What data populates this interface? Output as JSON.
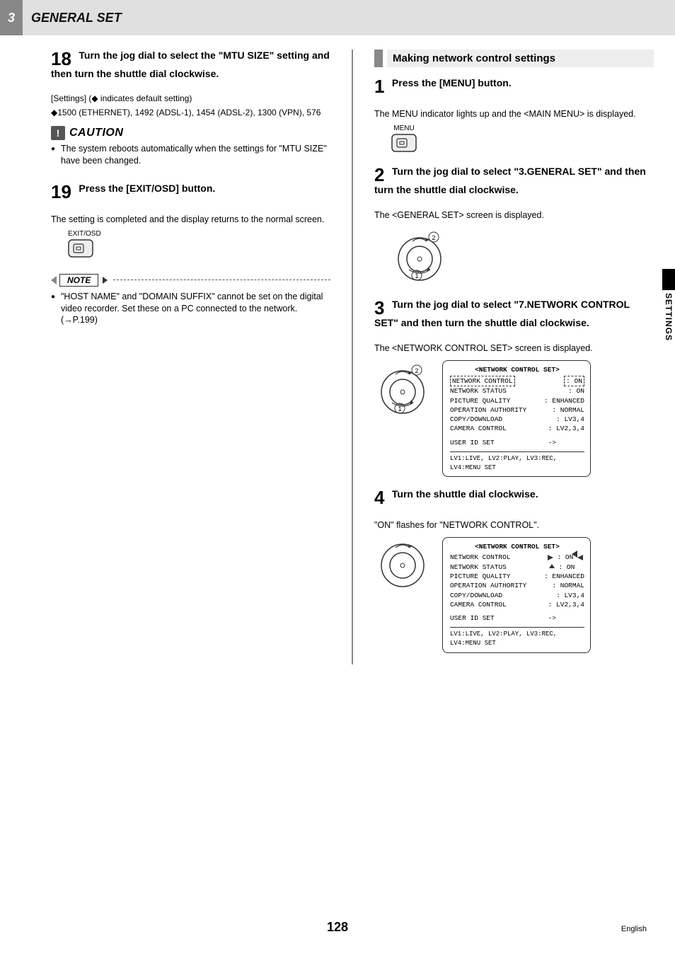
{
  "header": {
    "chapter_num": "3",
    "chapter_title": "GENERAL SET"
  },
  "side_tab": "SETTINGS",
  "footer": {
    "page": "128",
    "lang": "English"
  },
  "left": {
    "s18": {
      "num": "18",
      "title": "Turn the jog dial to select the \"MTU SIZE\" setting and then turn the shuttle dial clockwise.",
      "settings_label": "[Settings] (◆ indicates default setting)",
      "settings_body": "◆1500 (ETHERNET), 1492 (ADSL-1), 1454 (ADSL-2), 1300 (VPN), 576"
    },
    "caution": {
      "label": "CAUTION",
      "text": "The system reboots automatically when the settings for \"MTU SIZE\" have been changed."
    },
    "s19": {
      "num": "19",
      "title": "Press the [EXIT/OSD] button.",
      "body": "The setting is completed and the display returns to the normal screen.",
      "btn_label": "EXIT/OSD"
    },
    "note": {
      "label": "NOTE",
      "text": "\"HOST NAME\" and \"DOMAIN SUFFIX\" cannot be set on the digital video recorder. Set these on a PC connected to the network. (→P.199)"
    }
  },
  "right": {
    "section": "Making network control settings",
    "s1": {
      "num": "1",
      "title": "Press the [MENU] button.",
      "body": "The MENU indicator lights up and the <MAIN MENU> is displayed.",
      "btn_label": "MENU"
    },
    "s2": {
      "num": "2",
      "title": "Turn the jog dial to select \"3.GENERAL SET\" and then turn the shuttle dial clockwise.",
      "body": "The <GENERAL SET> screen is displayed."
    },
    "s3": {
      "num": "3",
      "title": "Turn the jog dial to select \"7.NETWORK CONTROL SET\" and then turn the shuttle dial clockwise.",
      "body": "The <NETWORK CONTROL SET> screen is displayed."
    },
    "s4": {
      "num": "4",
      "title": "Turn the shuttle dial clockwise.",
      "body": "\"ON\" flashes for \"NETWORK CONTROL\"."
    },
    "osd": {
      "title": "<NETWORK CONTROL SET>",
      "rows": [
        {
          "k": "NETWORK CONTROL",
          "v": ": ON"
        },
        {
          "k": "NETWORK STATUS",
          "v": ": ON"
        },
        {
          "k": "PICTURE QUALITY",
          "v": ": ENHANCED"
        },
        {
          "k": "OPERATION AUTHORITY",
          "v": ": NORMAL"
        },
        {
          "k": "COPY/DOWNLOAD",
          "v": ": LV3,4"
        },
        {
          "k": "CAMERA CONTROL",
          "v": ": LV2,3,4"
        }
      ],
      "userid": {
        "k": "USER ID SET",
        "v": "->"
      },
      "foot": "LV1:LIVE, LV2:PLAY, LV3:REC, LV4:MENU SET"
    }
  }
}
